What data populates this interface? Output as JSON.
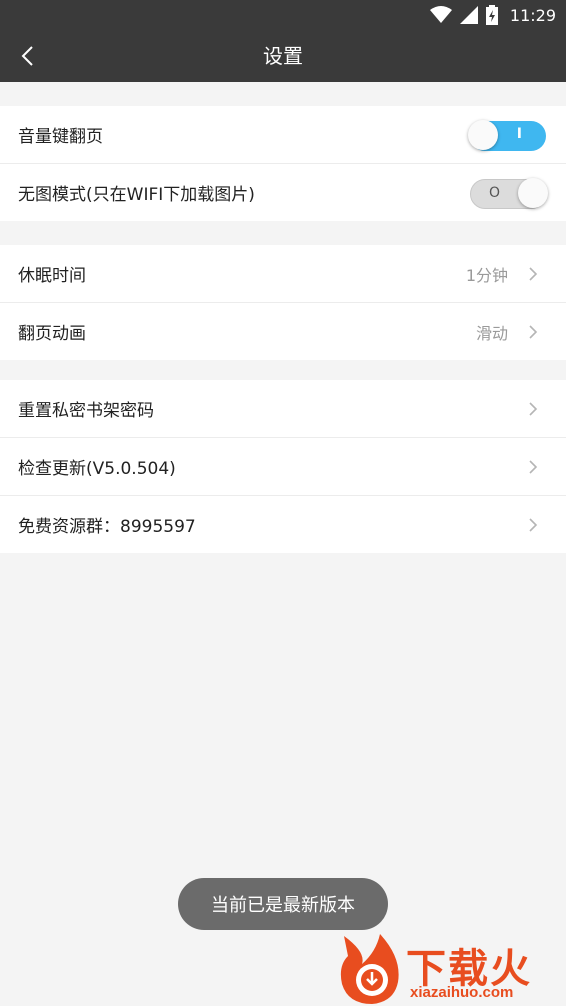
{
  "status_bar": {
    "time": "11:29",
    "wifi_icon": "wifi-icon",
    "signal_icon": "signal-icon",
    "battery_icon": "battery-charging-icon"
  },
  "app_bar": {
    "title": "设置",
    "back_icon": "chevron-left-icon"
  },
  "groups": [
    {
      "items": [
        {
          "label": "音量键翻页",
          "type": "toggle",
          "state": "on",
          "mark": "I"
        },
        {
          "label": "无图模式(只在WIFI下加载图片)",
          "type": "toggle",
          "state": "off",
          "mark": "O"
        }
      ]
    },
    {
      "items": [
        {
          "label": "休眠时间",
          "type": "value",
          "value": "1分钟"
        },
        {
          "label": "翻页动画",
          "type": "value",
          "value": "滑动"
        }
      ]
    },
    {
      "items": [
        {
          "label": "重置私密书架密码",
          "type": "link"
        },
        {
          "label": "检查更新(V5.0.504)",
          "type": "link"
        },
        {
          "label": "免费资源群：8995597",
          "type": "link"
        }
      ]
    }
  ],
  "toast": {
    "text": "当前已是最新版本"
  },
  "watermark": {
    "brand": "下载火",
    "url": "xiazaihuo.com"
  },
  "colors": {
    "bar": "#3a3a3a",
    "toggle_on": "#3fb7f0",
    "watermark": "#e84d1f"
  }
}
